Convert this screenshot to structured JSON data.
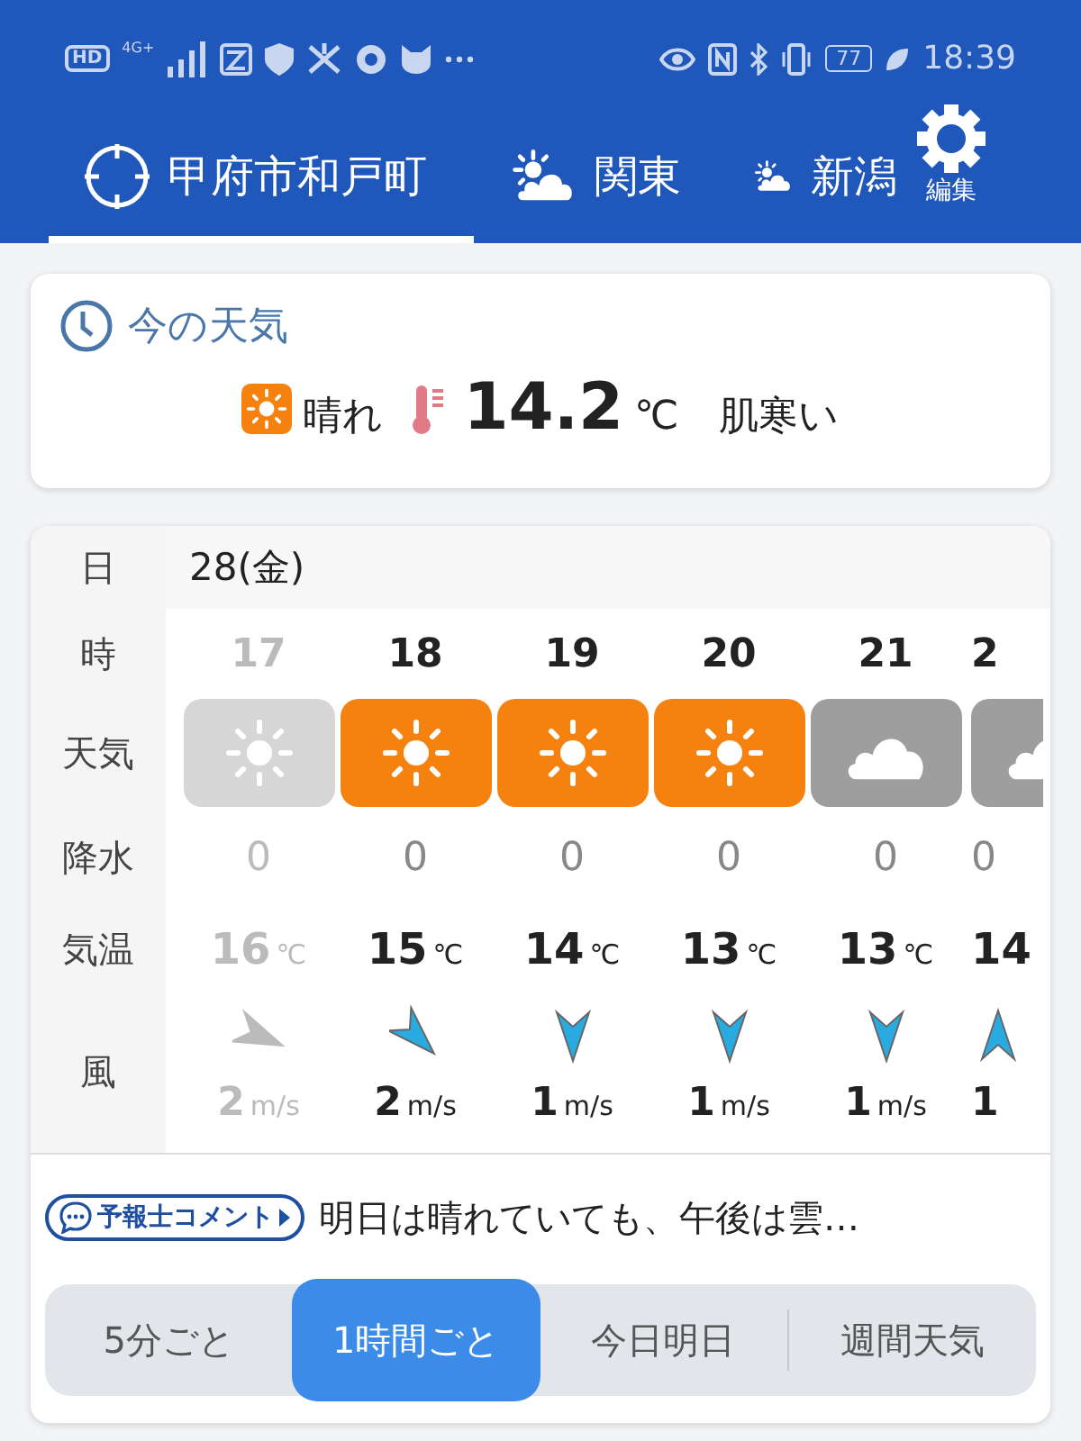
{
  "status_bar": {
    "hd": "HD",
    "network": "4G+",
    "battery": "77",
    "time": "18:39"
  },
  "tabs": [
    {
      "label": "甲府市和戸町",
      "kind": "location",
      "selected": true
    },
    {
      "label": "関東",
      "kind": "area",
      "selected": false
    },
    {
      "label": "新潟",
      "kind": "area",
      "selected": false
    }
  ],
  "edit_button": {
    "label": "編集"
  },
  "current": {
    "title": "今の天気",
    "kind": "sunny",
    "condition": "晴れ",
    "temperature": "14.2",
    "unit": "℃",
    "feeling": "肌寒い"
  },
  "hourly": {
    "row_labels": [
      "日",
      "時",
      "天気",
      "降水",
      "気温",
      "風"
    ],
    "date": "28(金)",
    "hours": [
      {
        "hour": "17",
        "past": true,
        "kind": "sunny",
        "precip": "0",
        "temp": "16",
        "temp_unit": "℃",
        "wind_arrow": {
          "kind": "WNW"
        },
        "wind_speed": "2",
        "wind_unit": "m/s"
      },
      {
        "hour": "18",
        "past": false,
        "kind": "sunny",
        "precip": "0",
        "temp": "15",
        "temp_unit": "℃",
        "wind_arrow": {
          "kind": "NW"
        },
        "wind_speed": "2",
        "wind_unit": "m/s"
      },
      {
        "hour": "19",
        "past": false,
        "kind": "sunny",
        "precip": "0",
        "temp": "14",
        "temp_unit": "℃",
        "wind_arrow": {
          "kind": "N"
        },
        "wind_speed": "1",
        "wind_unit": "m/s"
      },
      {
        "hour": "20",
        "past": false,
        "kind": "sunny",
        "precip": "0",
        "temp": "13",
        "temp_unit": "℃",
        "wind_arrow": {
          "kind": "N"
        },
        "wind_speed": "1",
        "wind_unit": "m/s"
      },
      {
        "hour": "21",
        "past": false,
        "kind": "cloudy",
        "precip": "0",
        "temp": "13",
        "temp_unit": "℃",
        "wind_arrow": {
          "kind": "N"
        },
        "wind_speed": "1",
        "wind_unit": "m/s"
      },
      {
        "hour": "2",
        "past": false,
        "kind": "cloudy",
        "precip": "0",
        "temp": "14",
        "wind_arrow": {
          "kind": "S"
        },
        "wind_speed": "1"
      }
    ]
  },
  "comment": {
    "badge": "予報士コメント",
    "text": "明日は晴れていても、午後は雲…"
  },
  "modes": [
    {
      "label": "5分ごと",
      "selected": false
    },
    {
      "label": "1時間ごと",
      "selected": true
    },
    {
      "label": "今日明日",
      "selected": false
    },
    {
      "label": "週間天気",
      "selected": false
    }
  ]
}
